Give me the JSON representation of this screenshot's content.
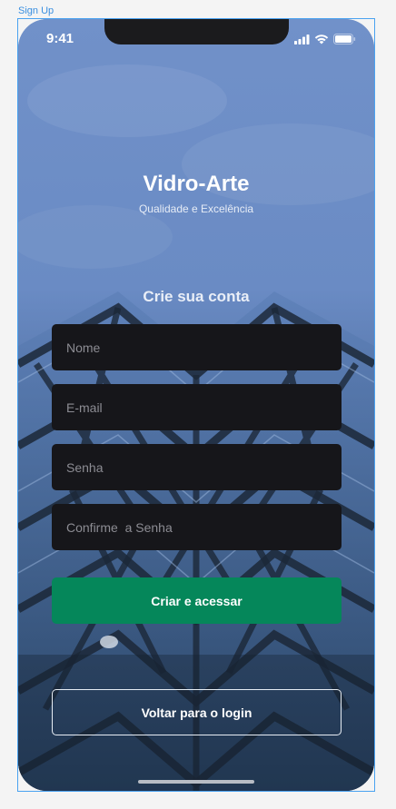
{
  "frame": {
    "label": "Sign Up"
  },
  "status_bar": {
    "time": "9:41"
  },
  "brand": {
    "title": "Vidro-Arte",
    "subtitle": "Qualidade e Excelência"
  },
  "form": {
    "heading": "Crie sua conta",
    "fields": [
      {
        "placeholder": "Nome",
        "value": ""
      },
      {
        "placeholder": "E-mail",
        "value": ""
      },
      {
        "placeholder": "Senha",
        "value": ""
      },
      {
        "placeholder": "Confirme  a Senha",
        "value": ""
      }
    ],
    "submit_label": "Criar e acessar",
    "back_label": "Voltar para o login"
  },
  "colors": {
    "primary_button": "#05875a",
    "field_background": "#16161a",
    "selection_outline": "#4aa2f0"
  }
}
